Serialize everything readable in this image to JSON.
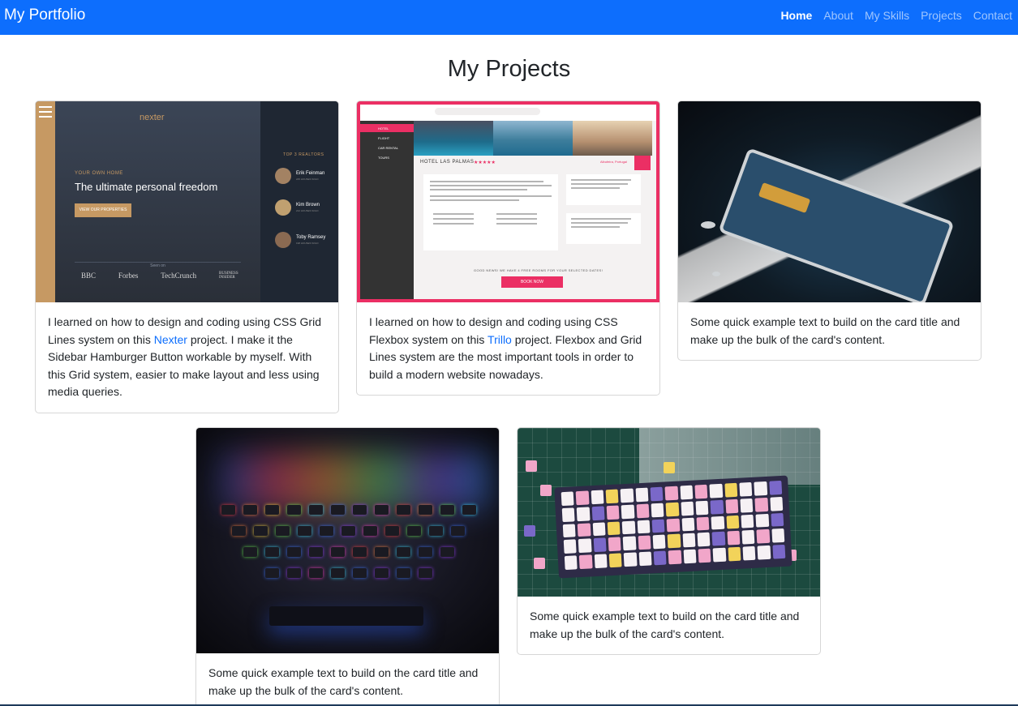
{
  "navbar": {
    "brand": "My Portfolio",
    "links": [
      "Home",
      "About",
      "My Skills",
      "Projects",
      "Contact"
    ],
    "active": "Home",
    "color": "#0d6efd"
  },
  "page_title": "My Projects",
  "cards": [
    {
      "text_before": "I learned on how to design and coding using CSS Grid Lines system on this ",
      "link": "Nexter",
      "text_after": " project. I make it the Sidebar Hamburger Button workable by myself. With this Grid system, easier to make layout and less using media queries.",
      "image": {
        "logo": "nexter",
        "tag": "YOUR OWN HOME",
        "headline": "The ultimate personal freedom",
        "button": "VIEW OUR PROPERTIES",
        "realtors_heading": "TOP 3 REALTORS",
        "realtors": [
          {
            "name": "Erik Feinman",
            "sub": "245 HOUSES SOLD"
          },
          {
            "name": "Kim Brown",
            "sub": "212 HOUSES SOLD"
          },
          {
            "name": "Toby Ramsey",
            "sub": "198 HOUSES SOLD"
          }
        ],
        "seen_on": "Seen on",
        "press": [
          "BBC",
          "Forbes",
          "TechCrunch",
          "BUSINESS INSIDER"
        ]
      }
    },
    {
      "text_before": "I learned on how to design and coding using CSS Flexbox system on this ",
      "link": "Trillo",
      "text_after": " project. Flexbox and Grid Lines system are the most important tools in order to build a modern website nowadays.",
      "image": {
        "hotel": "HOTEL LAS PALMAS",
        "stars": "★★★★★",
        "location": "Albufeira, Portugal",
        "nav": [
          "HOTEL",
          "FLIGHT",
          "CAR RENTAL",
          "TOURS"
        ],
        "cta_text": "GOOD NEWS! WE HAVE 4 FREE ROOMS FOR YOUR SELECTED DATES!",
        "cta_button": "BOOK NOW",
        "accent": "#eb2f64"
      }
    },
    {
      "text": "Some quick example text to build on the card title and make up the bulk of the card's content."
    },
    {
      "text": "Some quick example text to build on the card title and make up the bulk of the card's content."
    },
    {
      "text": "Some quick example text to build on the card title and make up the bulk of the card's content."
    }
  ]
}
